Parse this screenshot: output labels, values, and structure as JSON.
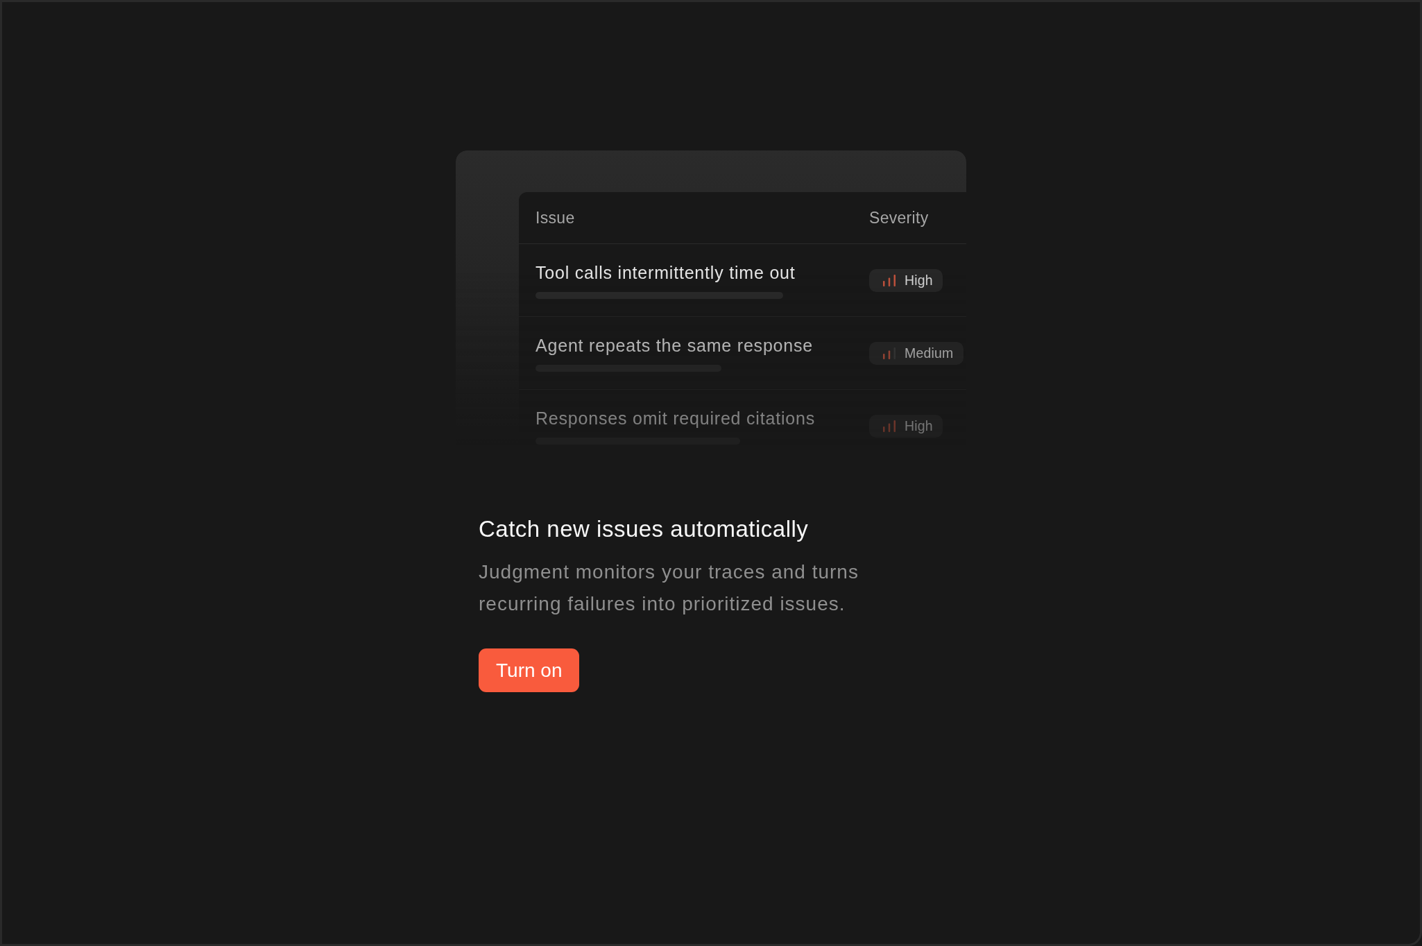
{
  "illustration": {
    "table": {
      "columns": [
        "Issue",
        "Severity"
      ],
      "rows": [
        {
          "issue": "Tool calls intermittently time out",
          "severity": {
            "label": "High",
            "kind": "high"
          }
        },
        {
          "issue": "Agent repeats the same response",
          "severity": {
            "label": "Medium",
            "kind": "medium"
          }
        },
        {
          "issue": "Responses omit required citations",
          "severity": {
            "label": "High",
            "kind": "high"
          }
        }
      ]
    }
  },
  "heading": "Catch new issues automatically",
  "description": "Judgment monitors your traces and turns recurring failures into prioritized issues.",
  "button": "Turn on"
}
